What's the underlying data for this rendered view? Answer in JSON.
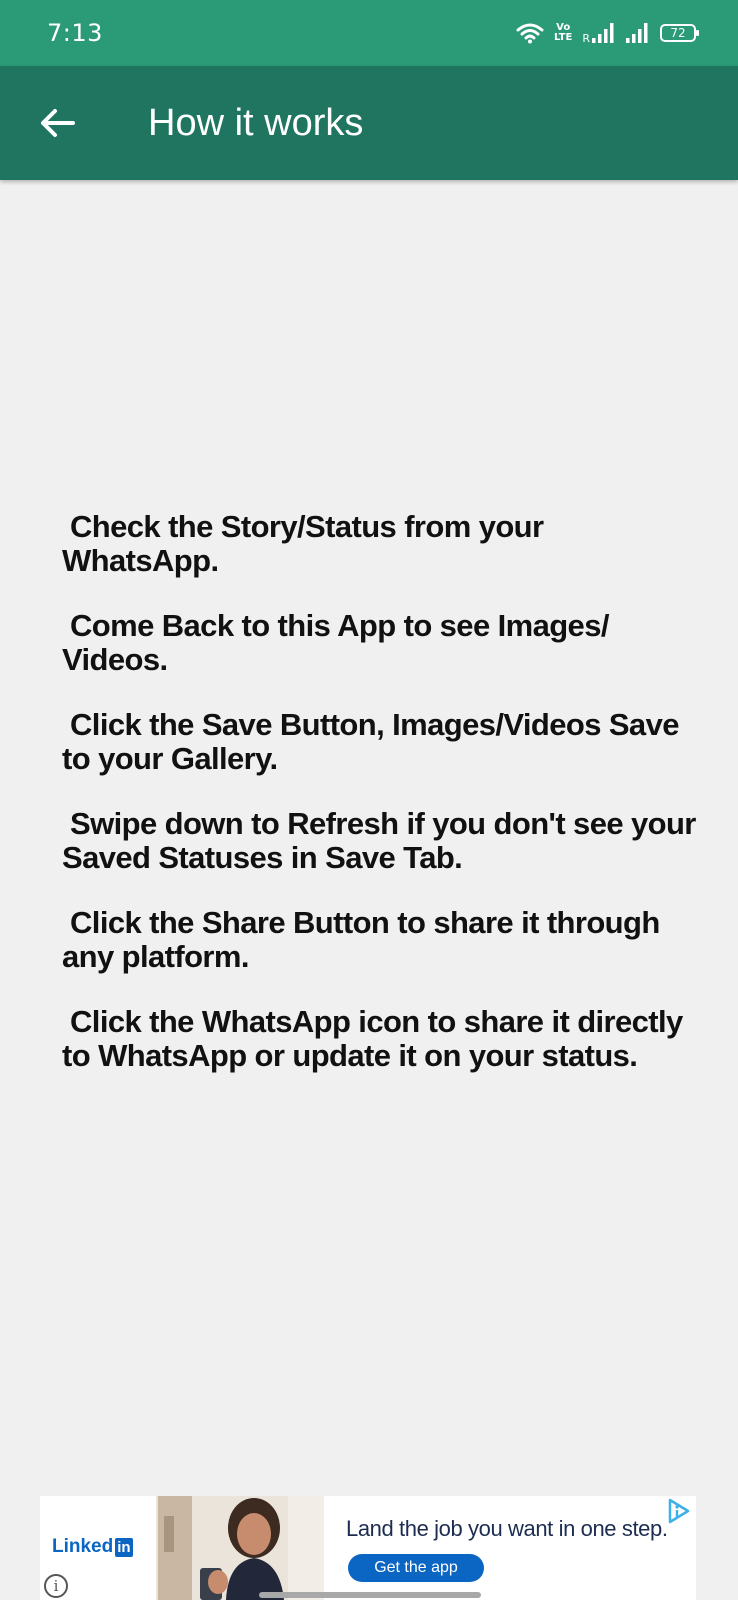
{
  "status_bar": {
    "time": "7:13",
    "volte_top": "Vo",
    "volte_bottom": "LTE",
    "roaming": "R",
    "battery": "72",
    "color": "#2b9a76"
  },
  "app_bar": {
    "title": "How it works",
    "back_icon": "arrow-left-icon",
    "color": "#207561"
  },
  "instructions": [
    " Check the Story/Status from your WhatsApp.",
    " Come Back to this App to see Images/ Videos.",
    " Click the Save Button, Images/Videos Save to your Gallery.",
    " Swipe down to Refresh if you don't see your Saved Statuses in Save Tab.",
    " Click the Share Button to share it through any platform.",
    " Click the WhatsApp icon to share it directly to WhatsApp or update it on your status."
  ],
  "ad": {
    "brand": "Linked",
    "brand_box": "in",
    "headline": "Land the job you want in one step.",
    "cta": "Get the app",
    "info": "i",
    "brand_color": "#0a66c2"
  }
}
